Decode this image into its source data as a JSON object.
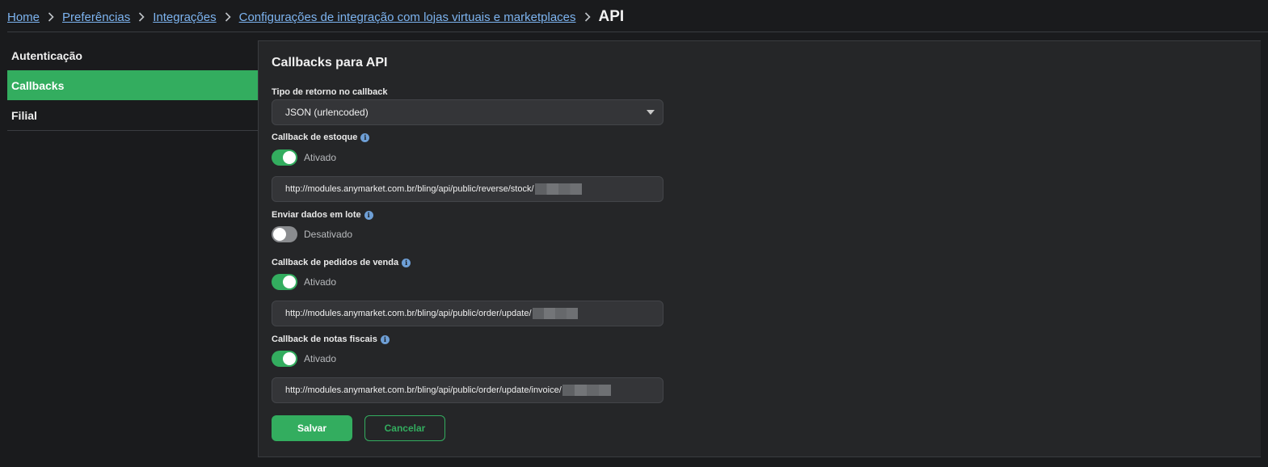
{
  "breadcrumb": {
    "items": [
      "Home",
      "Preferências",
      "Integrações",
      "Configurações de integração com lojas virtuais e marketplaces"
    ],
    "current": "API"
  },
  "sidebar": {
    "items": [
      {
        "label": "Autenticação"
      },
      {
        "label": "Callbacks"
      },
      {
        "label": "Filial"
      }
    ],
    "active_label": "Callbacks"
  },
  "panel": {
    "title": "Callbacks para API",
    "return_type": {
      "label": "Tipo de retorno no callback",
      "value": "JSON (urlencoded)"
    },
    "stock_callback": {
      "label": "Callback de estoque",
      "enabled": true,
      "status": "Ativado",
      "url": "http://modules.anymarket.com.br/bling/api/public/reverse/stock/"
    },
    "batch": {
      "label": "Enviar dados em lote",
      "enabled": false,
      "status": "Desativado"
    },
    "orders_callback": {
      "label": "Callback de pedidos de venda",
      "enabled": true,
      "status": "Ativado",
      "url": "http://modules.anymarket.com.br/bling/api/public/order/update/"
    },
    "invoice_callback": {
      "label": "Callback de notas fiscais",
      "enabled": true,
      "status": "Ativado",
      "url": "http://modules.anymarket.com.br/bling/api/public/order/update/invoice/"
    },
    "save_label": "Salvar",
    "cancel_label": "Cancelar"
  },
  "icons": {
    "info": "info-icon",
    "separator": "chevron-right-icon",
    "dropdown": "caret-down-icon"
  },
  "colors": {
    "accent": "#33ad5f",
    "link": "#7db4f0",
    "background": "#1a1b1d",
    "panel": "#252628"
  }
}
